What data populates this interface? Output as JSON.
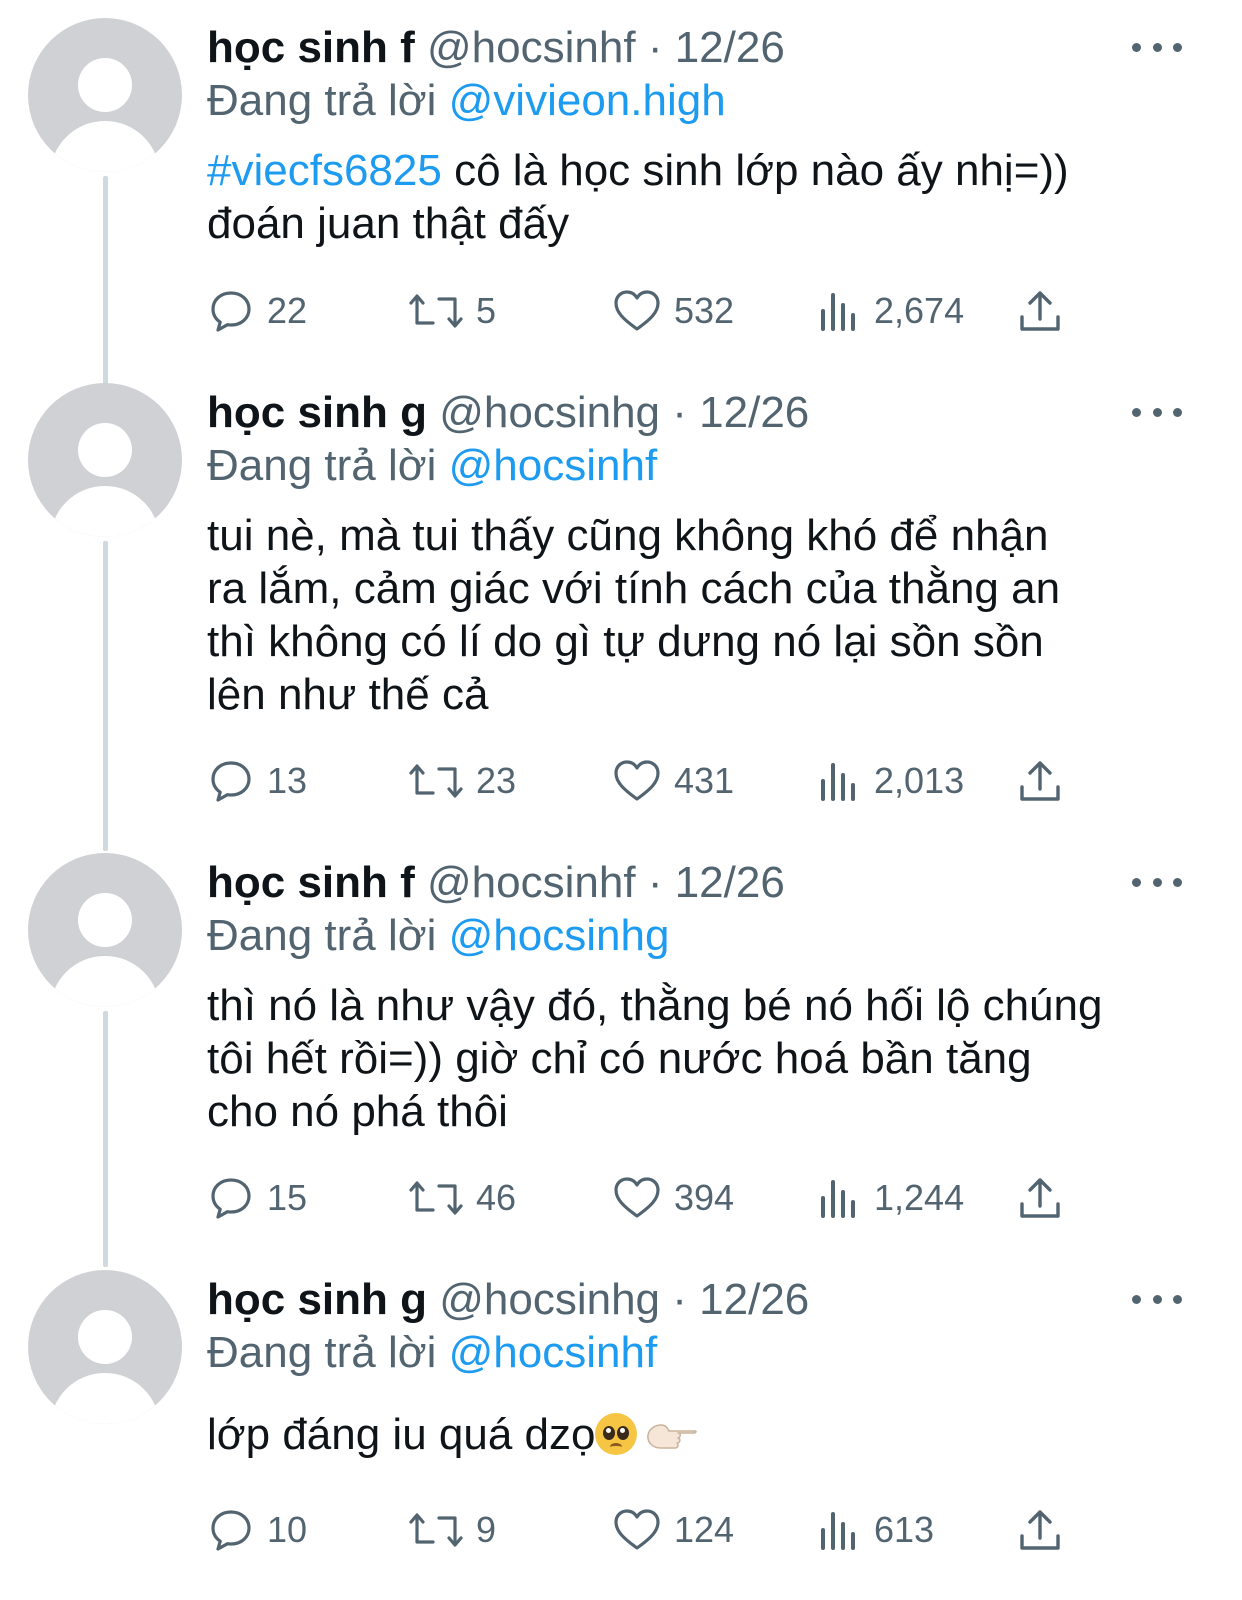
{
  "tweets": [
    {
      "name": "học sinh f",
      "handle": "@hocsinhf",
      "dot": "·",
      "date": "12/26",
      "reply_prefix": "Đang trả lời",
      "reply_to": "@vivieon.high",
      "hashtag": "#viecfs6825",
      "text_lines": [
        "cô là học sinh lớp nào ấy nhị=))",
        "đoán juan thật đấy"
      ],
      "replies": "22",
      "retweets": "5",
      "likes": "532",
      "views": "2,674"
    },
    {
      "name": "học sinh g",
      "handle": "@hocsinhg",
      "dot": "·",
      "date": "12/26",
      "reply_prefix": "Đang trả lời",
      "reply_to": "@hocsinhf",
      "text_lines": [
        "tui nè, mà tui thấy cũng không khó để nhận",
        "ra lắm, cảm giác với tính cách của thằng an",
        "thì không có lí do gì tự dưng nó lại sồn sồn",
        "lên như thế cả"
      ],
      "replies": "13",
      "retweets": "23",
      "likes": "431",
      "views": "2,013"
    },
    {
      "name": "học sinh f",
      "handle": "@hocsinhf",
      "dot": "·",
      "date": "12/26",
      "reply_prefix": "Đang trả lời",
      "reply_to": "@hocsinhg",
      "text_lines": [
        "thì nó là như vậy đó, thằng bé nó hối lộ chúng",
        "tôi hết rồi=)) giờ chỉ có nước hoá bần tăng",
        "cho nó phá thôi"
      ],
      "replies": "15",
      "retweets": "46",
      "likes": "394",
      "views": "1,244"
    },
    {
      "name": "học sinh g",
      "handle": "@hocsinhg",
      "dot": "·",
      "date": "12/26",
      "reply_prefix": "Đang trả lời",
      "reply_to": "@hocsinhf",
      "text_lines": [
        "lớp đáng iu quá dzọ"
      ],
      "replies": "10",
      "retweets": "9",
      "likes": "124",
      "views": "613"
    }
  ],
  "icons": {
    "reply": "reply-icon",
    "retweet": "retweet-icon",
    "like": "heart-icon",
    "views": "views-icon",
    "share": "share-icon",
    "more": "more-icon",
    "emoji_1": "pleading-face-icon",
    "emoji_2": "pointing-hand-icon"
  },
  "colors": {
    "accent": "#1d9bf0",
    "text": "#0f1419",
    "muted": "#536471",
    "avatar": "#cfd1d4",
    "thread_line": "#cfd9de"
  }
}
